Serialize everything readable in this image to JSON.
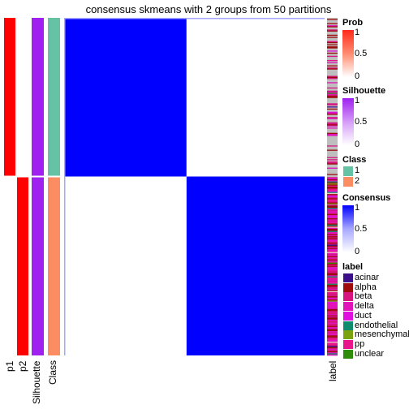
{
  "title": "consensus skmeans with 2 groups from 50 partitions",
  "columns": {
    "p1": "p1",
    "p2": "p2",
    "silhouette": "Silhouette",
    "class": "Class",
    "label": "label"
  },
  "legends": {
    "prob": {
      "title": "Prob",
      "ticks": [
        "1",
        "0.5",
        "0"
      ],
      "color_high": "#ff0000",
      "color_low": "#ffffff"
    },
    "silhouette": {
      "title": "Silhouette",
      "ticks": [
        "1",
        "0.5",
        "0"
      ],
      "color_high": "#a020f0",
      "color_low": "#ffffff"
    },
    "class": {
      "title": "Class",
      "items": [
        {
          "label": "1",
          "color": "#66c2a5"
        },
        {
          "label": "2",
          "color": "#fc8d62"
        }
      ]
    },
    "consensus": {
      "title": "Consensus",
      "ticks": [
        "1",
        "0.5",
        "0"
      ],
      "color_high": "#0000ff",
      "color_low": "#ffffff"
    },
    "label": {
      "title": "label",
      "items": [
        {
          "label": "acinar",
          "color": "#3b0f8a"
        },
        {
          "label": "alpha",
          "color": "#9e0a0a"
        },
        {
          "label": "beta",
          "color": "#d6137f"
        },
        {
          "label": "delta",
          "color": "#e012b8"
        },
        {
          "label": "duct",
          "color": "#e010e0"
        },
        {
          "label": "endothelial",
          "color": "#0f8c6b"
        },
        {
          "label": "mesenchymal",
          "color": "#7ba30f"
        },
        {
          "label": "pp",
          "color": "#e8168a"
        },
        {
          "label": "unclear",
          "color": "#2e8c0a"
        }
      ]
    }
  },
  "chart_data": {
    "type": "heatmap",
    "title": "consensus skmeans with 2 groups from 50 partitions",
    "k": 2,
    "partitions": 50,
    "groups": [
      {
        "class": "1",
        "fraction_of_samples": 0.47,
        "p1": 1.0,
        "p2": 0.0,
        "silhouette": 1.0
      },
      {
        "class": "2",
        "fraction_of_samples": 0.53,
        "p1": 0.0,
        "p2": 1.0,
        "silhouette": 1.0
      }
    ],
    "consensus_blocks": [
      {
        "rows": "class 1",
        "cols": "class 1",
        "value": 1
      },
      {
        "rows": "class 1",
        "cols": "class 2",
        "value": 0
      },
      {
        "rows": "class 2",
        "cols": "class 1",
        "value": 0
      },
      {
        "rows": "class 2",
        "cols": "class 2",
        "value": 1
      }
    ],
    "annotation_columns": [
      "p1",
      "p2",
      "Silhouette",
      "Class"
    ],
    "row_annotation": "label",
    "legend_position": "right",
    "color_scales": {
      "Prob": {
        "range": [
          0,
          1
        ]
      },
      "Silhouette": {
        "range": [
          0,
          1
        ]
      },
      "Consensus": {
        "range": [
          0,
          1
        ]
      }
    }
  }
}
